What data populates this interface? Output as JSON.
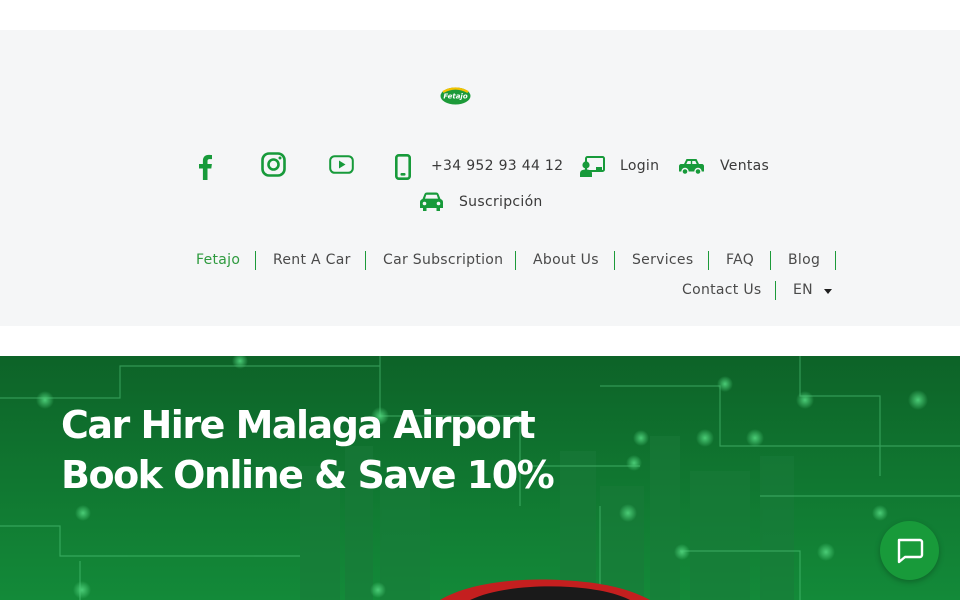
{
  "header": {
    "logo_text": "Fetajo",
    "phone": "+34 952 93 44 12",
    "login_label": "Login",
    "ventas_label": "Ventas",
    "suscripcion_label": "Suscripción",
    "social_icons": [
      "facebook-icon",
      "instagram-icon",
      "youtube-icon"
    ]
  },
  "nav": {
    "items": [
      "Fetajo",
      "Rent A Car",
      "Car Subscription",
      "About Us",
      "Services",
      "FAQ",
      "Blog",
      "Contact Us"
    ],
    "language": "EN"
  },
  "hero": {
    "title_line1": "Car Hire Malaga Airport",
    "title_line2": "Book Online & Save 10%"
  },
  "colors": {
    "brand_green": "#1c9a39",
    "active_nav": "#2e9a3e",
    "hero_bg": "#106a2d",
    "header_bg": "#f5f6f7"
  }
}
